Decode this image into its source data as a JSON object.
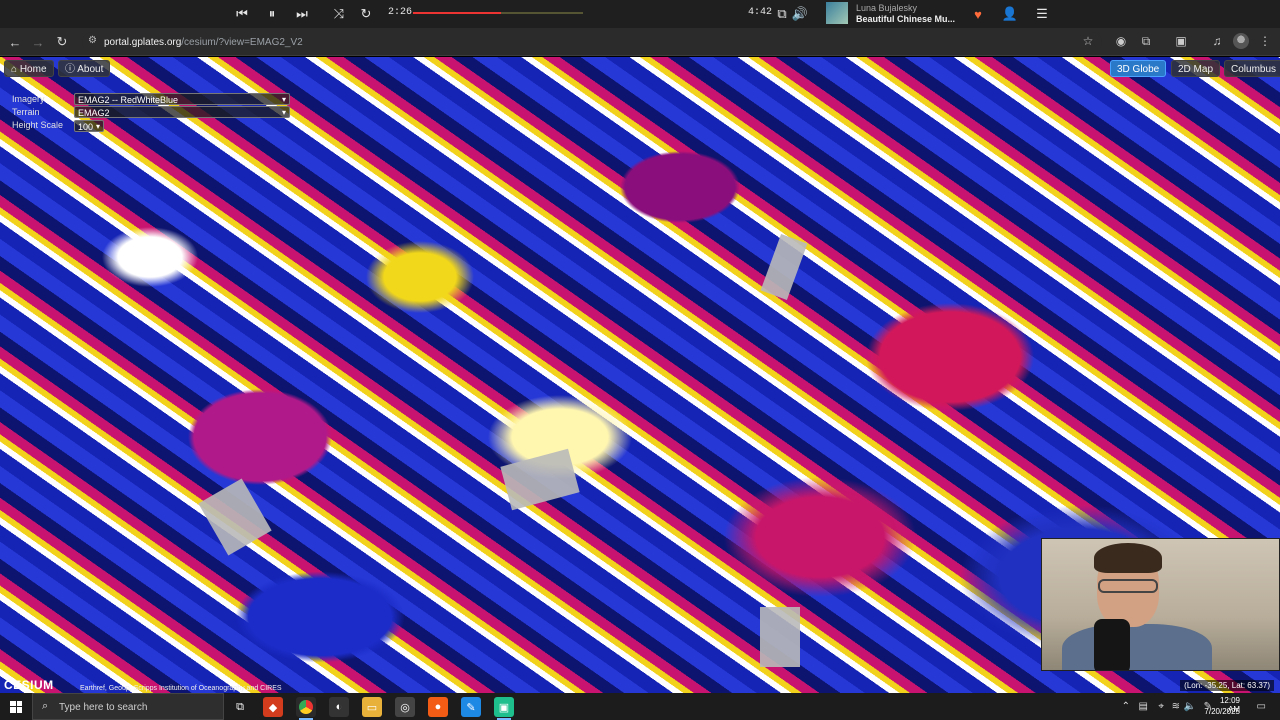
{
  "media_bar": {
    "elapsed": "2:26",
    "total": "4:42",
    "progress_fraction": 0.52,
    "artist": "Luna Bujalesky",
    "title": "Beautiful Chinese Mu..."
  },
  "browser": {
    "url_host": "portal.gplates.org",
    "url_path": "/cesium/?view=EMAG2_V2"
  },
  "toolbar": {
    "home_label": "Home",
    "about_label": "About",
    "view_3d_label": "3D Globe",
    "view_2d_label": "2D Map",
    "view_columbus_label": "Columbus"
  },
  "layers": {
    "imagery_label": "Imagery",
    "imagery_value": "EMAG2 -- RedWhiteBlue",
    "terrain_label": "Terrain",
    "terrain_value": "EMAG2",
    "height_label": "Height Scale",
    "height_value": "100"
  },
  "credits": {
    "logo": "CESIUM",
    "text": "Earthref, Geoup, Scripps Institution of Oceanography and CIRES"
  },
  "coords": {
    "text": "(Lon: -35.25,  Lat: 63.37)"
  },
  "taskbar": {
    "search_placeholder": "Type here to search",
    "time": "12:09 AM",
    "date": "7/20/2025"
  }
}
